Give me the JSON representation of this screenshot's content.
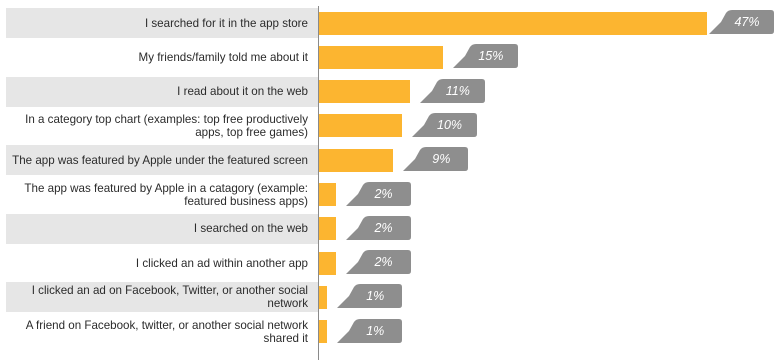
{
  "chart_data": {
    "type": "bar",
    "orientation": "horizontal",
    "categories": [
      "I searched for it in the app store",
      "My friends/family told me about it",
      "I read about it on the web",
      "In a category top chart (examples: top free productively apps, top free games)",
      "The app was featured by Apple under the featured screen",
      "The app was featured by Apple in a catagory (example: featured business apps)",
      "I searched on the web",
      "I clicked an ad within another app",
      "I clicked an ad on Facebook, Twitter, or another social network",
      "A friend on Facebook, twitter, or another social network shared it"
    ],
    "values": [
      47,
      15,
      11,
      10,
      9,
      2,
      2,
      2,
      1,
      1
    ],
    "value_labels": [
      "47%",
      "15%",
      "11%",
      "10%",
      "9%",
      "2%",
      "2%",
      "2%",
      "1%",
      "1%"
    ],
    "xlim": [
      0,
      47
    ],
    "title": "",
    "xlabel": "",
    "ylabel": "",
    "grid": false,
    "legend": "none"
  },
  "colors": {
    "bar": "#fcb530",
    "band": "#e6e6e6",
    "tag": "#8e8e8e",
    "axis": "#8a8a8a",
    "label_text": "#2b2b2b",
    "tag_text": "#ffffff"
  }
}
